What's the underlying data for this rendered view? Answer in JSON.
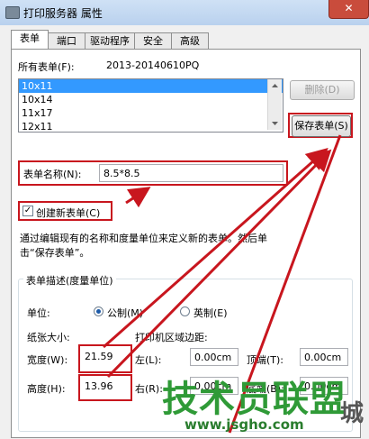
{
  "window": {
    "title": "打印服务器 属性",
    "close_glyph": "✕"
  },
  "tabs": [
    {
      "label": "表单"
    },
    {
      "label": "端口"
    },
    {
      "label": "驱动程序"
    },
    {
      "label": "安全"
    },
    {
      "label": "高级"
    }
  ],
  "forms_on": {
    "label": "所有表单(F):",
    "server": "2013-20140610PQ"
  },
  "form_list": [
    "10x11",
    "10x14",
    "11x17",
    "12x11"
  ],
  "buttons": {
    "delete": "删除(D)",
    "save": "保存表单(S)"
  },
  "form_name": {
    "label": "表单名称(N):",
    "value": "8.5*8.5"
  },
  "create_new": {
    "label": "创建新表单(C)",
    "checked": true
  },
  "description": "通过编辑现有的名称和度量单位来定义新的表单。然后单击“保存表单”。",
  "group": {
    "title": "表单描述(度量单位)",
    "unit_label": "单位:",
    "metric": "公制(M)",
    "english": "英制(E)",
    "paper_size": "纸张大小:",
    "margins": "打印机区域边距:",
    "width": {
      "label": "宽度(W):",
      "value": "21.59"
    },
    "height": {
      "label": "高度(H):",
      "value": "13.96"
    },
    "left": {
      "label": "左(L):",
      "value": "0.00cm"
    },
    "right": {
      "label": "右(R):",
      "value": "0.00cm"
    },
    "top": {
      "label": "顶端(T):",
      "value": "0.00cm"
    },
    "bottom": {
      "label": "底端(B):",
      "value": "0.00cm"
    }
  },
  "watermark": {
    "text": "技术员联盟",
    "url": "www.jsgho.com",
    "city": "城"
  },
  "colors": {
    "annotation_red": "#c8161e",
    "selection": "#3399ff"
  }
}
